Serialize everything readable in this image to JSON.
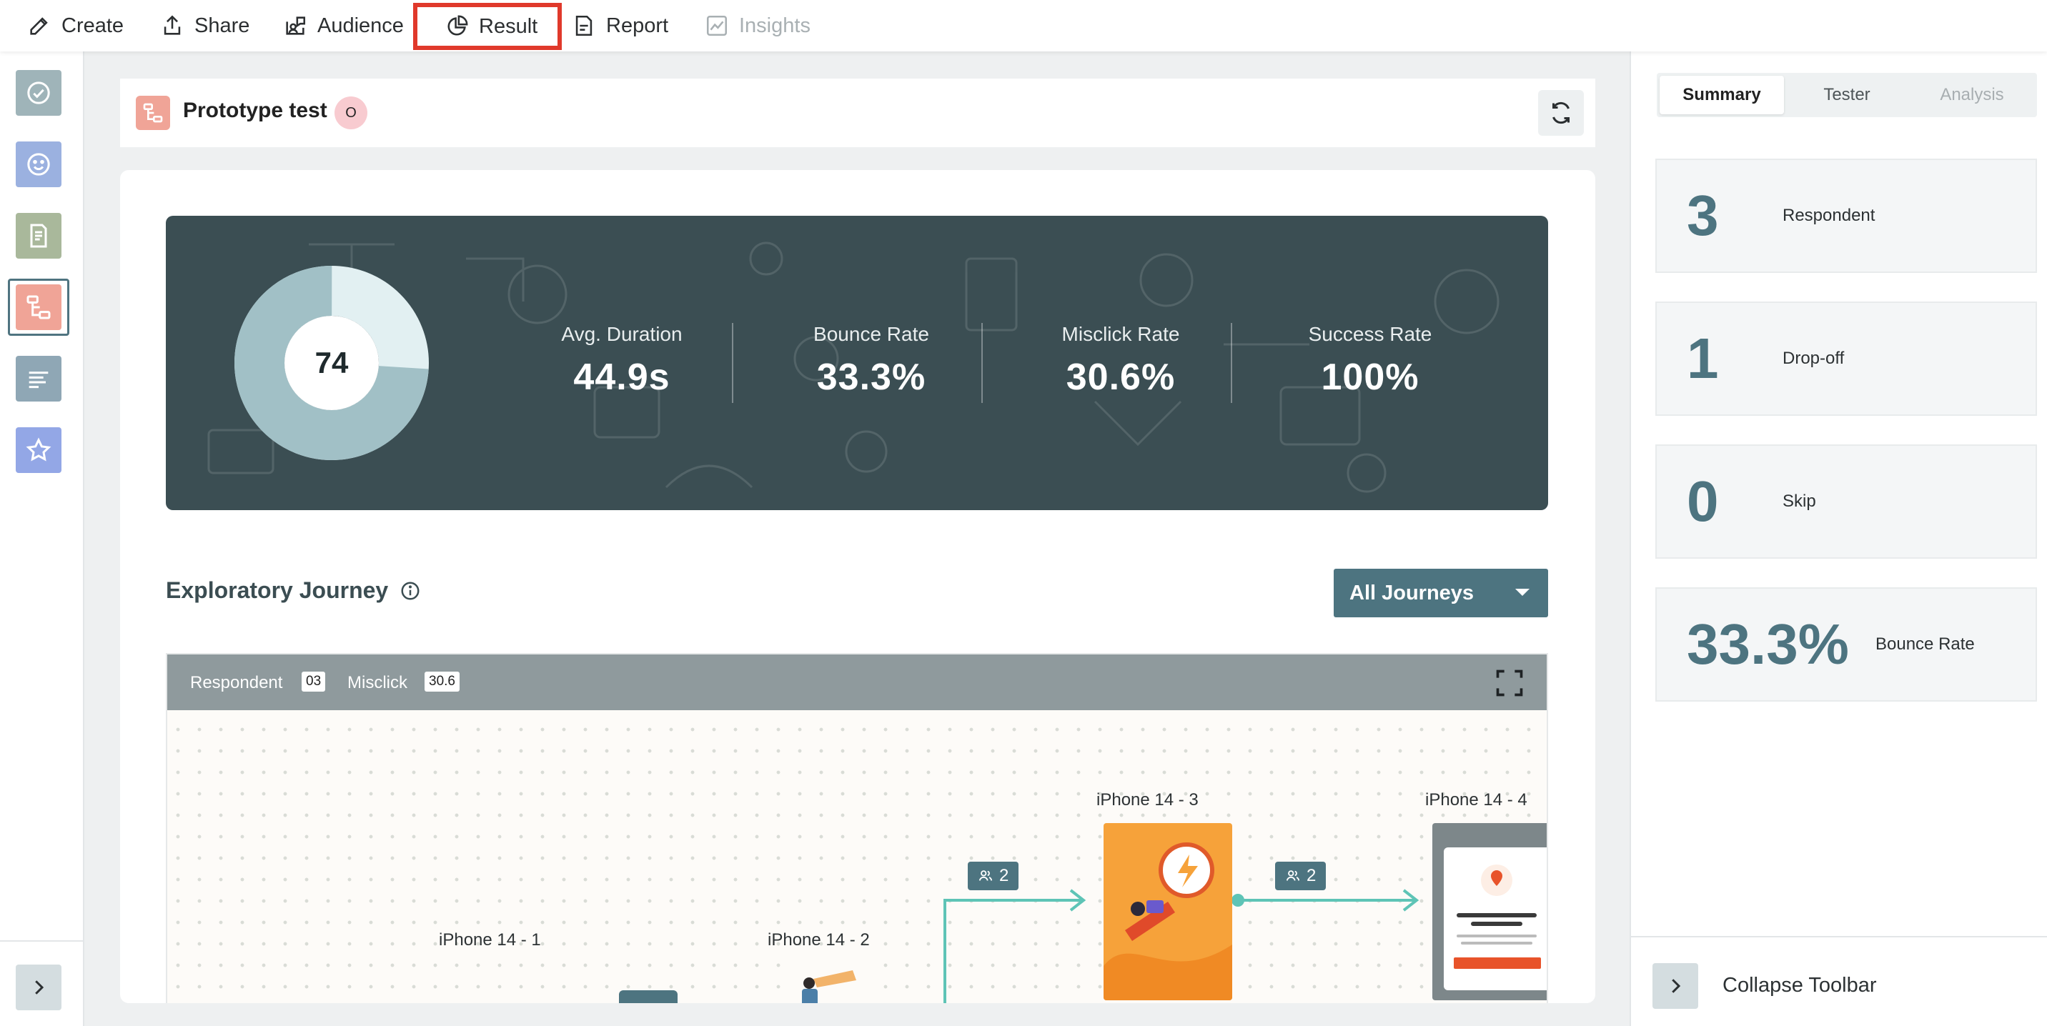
{
  "nav": {
    "items": [
      {
        "label": "Create",
        "icon": "pencil-icon"
      },
      {
        "label": "Share",
        "icon": "share-icon"
      },
      {
        "label": "Audience",
        "icon": "audience-icon"
      },
      {
        "label": "Result",
        "icon": "pie-chart-icon",
        "highlighted": true
      },
      {
        "label": "Report",
        "icon": "report-icon"
      },
      {
        "label": "Insights",
        "icon": "trend-icon",
        "disabled": true
      }
    ]
  },
  "leftrail": {
    "items": [
      {
        "icon": "check-circle-icon",
        "color": "#9fb4b9"
      },
      {
        "icon": "smiley-icon",
        "color": "#9bb1e0"
      },
      {
        "icon": "document-icon",
        "color": "#a9b89b"
      },
      {
        "icon": "prototype-flow-icon",
        "color": "#f0a497",
        "active": true
      },
      {
        "icon": "text-lines-icon",
        "color": "#8fa7b5"
      },
      {
        "icon": "star-icon",
        "color": "#93a7e6"
      }
    ]
  },
  "header": {
    "title": "Prototype test",
    "badge": "O"
  },
  "summary": {
    "score": "74",
    "score_fraction": 0.74,
    "stats": [
      {
        "label": "Avg. Duration",
        "value": "44.9s"
      },
      {
        "label": "Bounce Rate",
        "value": "33.3%"
      },
      {
        "label": "Misclick Rate",
        "value": "30.6%"
      },
      {
        "label": "Success Rate",
        "value": "100%"
      }
    ]
  },
  "journey": {
    "title": "Exploratory Journey",
    "filter": "All Journeys",
    "respondent_label": "Respondent",
    "respondent_value": "03",
    "misclick_label": "Misclick",
    "misclick_value": "30.6",
    "screens": [
      "iPhone 14 - 1",
      "iPhone 14 - 2",
      "iPhone 14 - 3",
      "iPhone 14 - 4"
    ],
    "flows": [
      "2",
      "2"
    ]
  },
  "rightpanel": {
    "tabs": [
      "Summary",
      "Tester",
      "Analysis"
    ],
    "metrics": [
      {
        "value": "3",
        "label": "Respondent"
      },
      {
        "value": "1",
        "label": "Drop-off"
      },
      {
        "value": "0",
        "label": "Skip"
      },
      {
        "value": "33.3%",
        "label": "Bounce Rate"
      }
    ],
    "collapse_label": "Collapse Toolbar"
  },
  "colors": {
    "accent": "#4d7480",
    "banner": "#3b4e53",
    "highlight": "#e0392b",
    "flow_line": "#5ec4b6"
  }
}
